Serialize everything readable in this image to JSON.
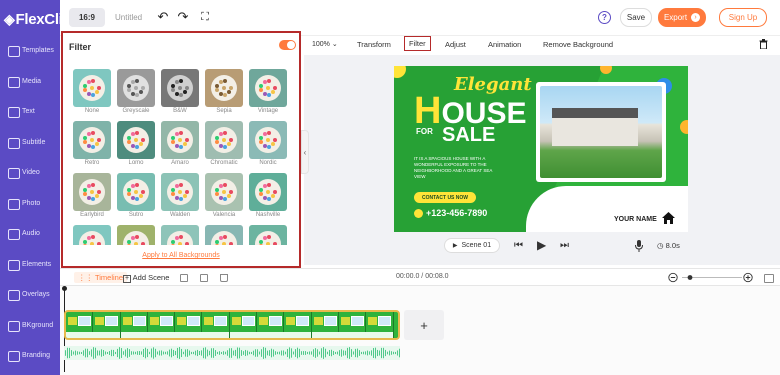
{
  "app": {
    "logo_text": "FlexClip",
    "doc_title": "Untitled",
    "aspect_ratio": "16:9",
    "help_label": "?",
    "save_label": "Save",
    "export_label": "Export",
    "signup_label": "Sign Up",
    "accent_color": "#ff7a3d",
    "brand_color": "#5b4bc4"
  },
  "sidebar": {
    "items": [
      {
        "label": "Templates",
        "icon": "templates-icon"
      },
      {
        "label": "Media",
        "icon": "media-icon"
      },
      {
        "label": "Text",
        "icon": "text-icon"
      },
      {
        "label": "Subtitle",
        "icon": "subtitle-icon"
      },
      {
        "label": "Video",
        "icon": "video-icon"
      },
      {
        "label": "Photo",
        "icon": "photo-icon"
      },
      {
        "label": "Audio",
        "icon": "audio-icon"
      },
      {
        "label": "Elements",
        "icon": "elements-icon"
      },
      {
        "label": "Overlays",
        "icon": "overlays-icon"
      },
      {
        "label": "BKground",
        "icon": "background-icon"
      },
      {
        "label": "Branding",
        "icon": "branding-icon"
      }
    ]
  },
  "filter_panel": {
    "title": "Filter",
    "enabled": true,
    "apply_all_label": "Apply to All Backgrounds",
    "filters": [
      {
        "name": "None"
      },
      {
        "name": "Greyscale"
      },
      {
        "name": "B&W"
      },
      {
        "name": "Sepia"
      },
      {
        "name": "Vintage"
      },
      {
        "name": "Retro"
      },
      {
        "name": "Lomo"
      },
      {
        "name": "Amaro"
      },
      {
        "name": "Chromatic"
      },
      {
        "name": "Nordic"
      },
      {
        "name": "Earlybird"
      },
      {
        "name": "Sutro"
      },
      {
        "name": "Walden"
      },
      {
        "name": "Valencia"
      },
      {
        "name": "Nashville"
      },
      {
        "name": ""
      },
      {
        "name": ""
      },
      {
        "name": ""
      },
      {
        "name": ""
      },
      {
        "name": ""
      }
    ]
  },
  "edit_toolbar": {
    "zoom": "100%",
    "tabs": [
      "Transform",
      "Filter",
      "Adjust",
      "Animation",
      "Remove Background"
    ],
    "active_tab": "Filter"
  },
  "design": {
    "elegant": "Elegant",
    "house_h": "H",
    "house_rest": "OUSE",
    "for": "FOR",
    "sale": "SALE",
    "description": "IT IS A SPACIOUS HOUSE WITH A WONDERFUL EXPOSURE TO THE NEIGHBORHOOD AND A GREAT SEA VIEW",
    "contact": "CONTACT US NOW",
    "phone": "+123-456-7890",
    "name": "YOUR NAME"
  },
  "playback": {
    "scene_label": "Scene 01",
    "duration": "8.0s"
  },
  "timeline": {
    "label": "Timeline",
    "add_scene_label": "Add Scene",
    "time": "00:00.0 / 00:08.0",
    "add_clip": "+"
  }
}
